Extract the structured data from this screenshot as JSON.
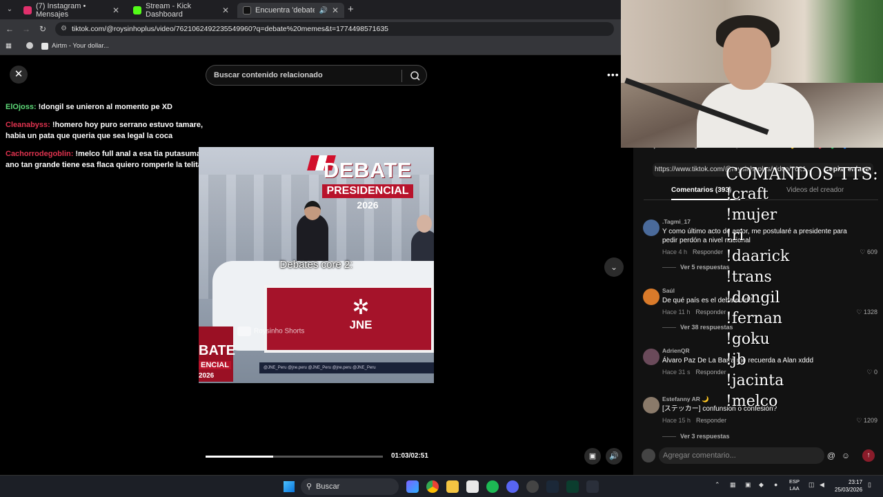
{
  "browser": {
    "tabs": [
      {
        "label": "(7) Instagram • Mensajes",
        "fav_color": "#e1306c"
      },
      {
        "label": "Stream - Kick Dashboard",
        "fav_color": "#53fc18"
      },
      {
        "label": "Encuentra 'debate memes'",
        "fav_color": "#111111"
      }
    ],
    "url": "tiktok.com/@roysinhoplus/video/7621062492235549960?q=debate%20memes&t=1774498571635",
    "bookmark": "Airtm - Your dollar..."
  },
  "tiktok": {
    "search_placeholder": "Buscar contenido relacionado",
    "video": {
      "title_line1": "DEBATE",
      "title_line2": "PRESIDENCIAL",
      "title_year": "2026",
      "subtitle": "Debates core 2:",
      "desk_label": "JNE",
      "watermark": "Roysinho Shorts",
      "corner_line1": "BATE",
      "corner_line2": "ENCIAL",
      "corner_line3": "2026",
      "strip_text": "@JNE_Peru   @jne.peru   @JNE_Peru   @jne.peru   @JNE_Peru",
      "progress": 0.38,
      "time": "01:03/02:51"
    },
    "panel": {
      "share_url": "https://www.tiktok.com/@roysinhoplus/video/7621...",
      "copy_label": "Copiar enlace",
      "tab_comments": "Comentarios (393)",
      "tab_creator": "Videos del creador",
      "comments": [
        {
          "name": ".Tagmi_17",
          "text": "Y como último acto de amor, me postularé a presidente para pedir perdón a nivel nacional",
          "time": "Hace 4 h",
          "reply": "Responder",
          "likes": "609",
          "more": "Ver 5 respuestas",
          "avatar": "#4a6a9a"
        },
        {
          "name": "Saúl",
          "text": "De qué país es el debate xd?",
          "time": "Hace 11 h",
          "reply": "Responder",
          "likes": "1328",
          "more": "Ver 38 respuestas",
          "avatar": "#d97a2a"
        },
        {
          "name": "AdrienQR",
          "text": "Álvaro Paz De La Barra me recuerda a Alan xddd",
          "time": "Hace 31 s",
          "reply": "Responder",
          "likes": "0",
          "more": "",
          "avatar": "#6a4a5a"
        },
        {
          "name": "Estefanny AR 🌙",
          "text": "[ステッカー] confunsion o confesión?",
          "time": "Hace 15 h",
          "reply": "Responder",
          "likes": "1209",
          "more": "Ver 3 respuestas",
          "avatar": "#8a7a6a"
        }
      ],
      "input_placeholder": "Agregar comentario..."
    }
  },
  "chat": [
    {
      "user": "ElOjoss:",
      "color": "#5fdc7a",
      "text": "!dongil se unieron al momento pe XD"
    },
    {
      "user": "Cleanabyss:",
      "color": "#e0334f",
      "text": "!homero hoy puro serrano estuvo tamare, habia un pata que queria que sea legal la coca"
    },
    {
      "user": "Cachorrodegoblin:",
      "color": "#e0334f",
      "text": "!melco full anal a esa tia putasumare que ano tan grande tiene esa flaca quiero romperle la telita"
    }
  ],
  "overlay_commands": {
    "title": "COMANDOS TTS:",
    "items": [
      "!craft",
      "!mujer",
      "!ri",
      "!daarick",
      "!trans",
      "!dongil",
      "!fernan",
      "!goku",
      "!jb",
      "!jacinta",
      "!melco"
    ]
  },
  "taskbar": {
    "search_label": "Buscar",
    "lang": "ESP",
    "lang2": "LAA",
    "time": "23:17",
    "date": "25/03/2026"
  }
}
